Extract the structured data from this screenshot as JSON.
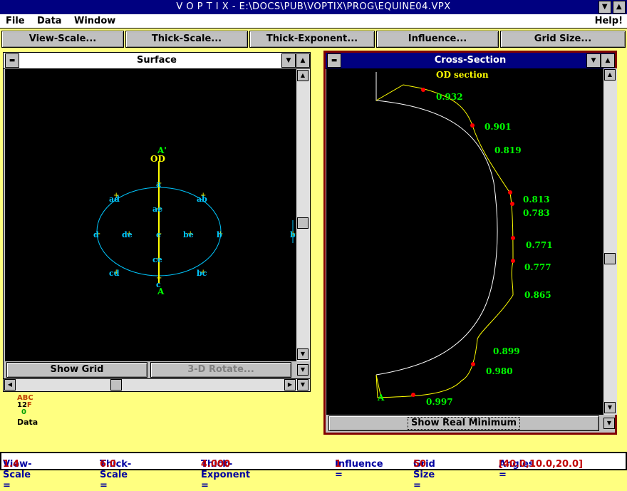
{
  "app": {
    "title": "V O P T I X - E:\\DOCS\\PUB\\VOPTIX\\PROG\\EQUINE04.VPX"
  },
  "menu": {
    "file": "File",
    "data": "Data",
    "window": "Window",
    "help": "Help!"
  },
  "toolbar": {
    "view_scale": "View-Scale...",
    "thick_scale": "Thick-Scale...",
    "thick_exponent": "Thick-Exponent...",
    "influence": "Influence...",
    "grid_size": "Grid Size..."
  },
  "surface_window": {
    "title": "Surface",
    "show_grid": "Show Grid",
    "rotate_3d": "3-D Rotate...",
    "labels": {
      "a_prime": "A'",
      "od": "OD",
      "a_bottom": "A",
      "c": "c",
      "a": "a",
      "ae": "ae",
      "e": "e",
      "ce": "ce",
      "ad": "ad",
      "ab": "ab",
      "d": "d",
      "de": "de",
      "be": "be",
      "b": "b",
      "cd": "cd",
      "bc": "bc",
      "b_right": "b"
    }
  },
  "cross_section_window": {
    "title": "Cross-Section",
    "subtitle": "OD section",
    "a_label": "A",
    "show_real_minimum": "Show Real Minimum",
    "values": [
      "0.932",
      "0.901",
      "0.819",
      "0.813",
      "0.783",
      "0.771",
      "0.777",
      "0.865",
      "0.899",
      "0.980",
      "0.997"
    ]
  },
  "legend": {
    "line1": "ABC",
    "line2_a": "12",
    "line2_b": "F",
    "line3": "0",
    "data_label": "Data"
  },
  "status": {
    "view_scale_label": "View-Scale =",
    "view_scale": "1.4",
    "thick_scale_label": "Thick-Scale =",
    "thick_scale": "6.0",
    "thick_exp_label": "Thick-Exponent =",
    "thick_exp": "4.000",
    "influence_label": "Influence =",
    "influence": "1",
    "grid_label": "Grid Size =",
    "grid": "50",
    "angles_label": "Angles =",
    "angles": "[40.0,10.0,20.0]"
  },
  "colors": {
    "cyan": "#00c8ff",
    "yellow": "#ffff00",
    "green": "#00ff00",
    "red": "#ff0000",
    "title_blue": "#000080"
  }
}
